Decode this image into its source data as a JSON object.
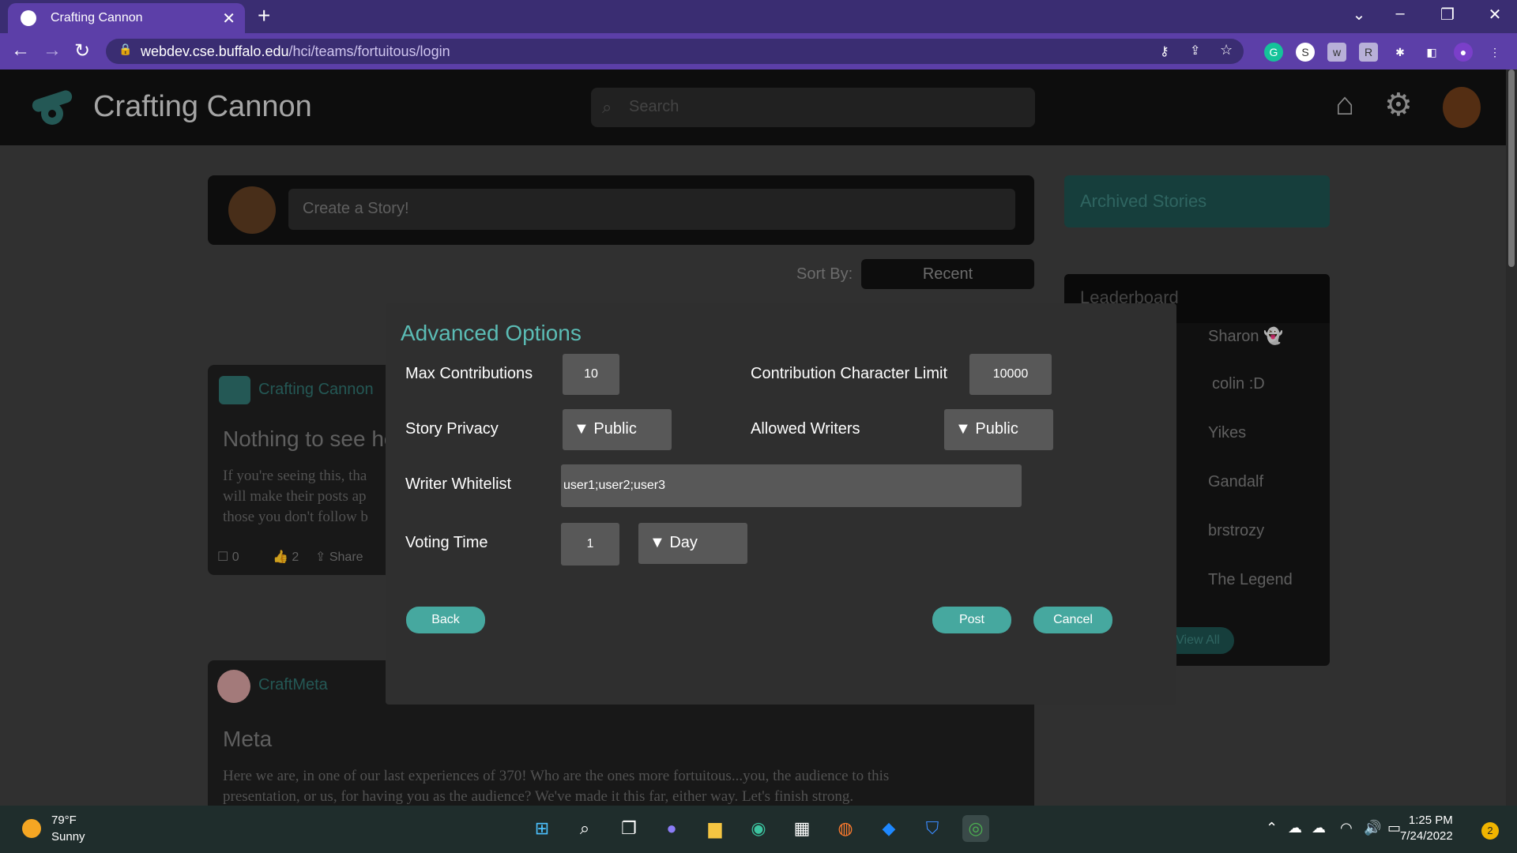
{
  "browser": {
    "tab_title": "Crafting Cannon",
    "url_host": "webdev.cse.buffalo.edu",
    "url_path": "/hci/teams/fortuitous/login"
  },
  "site": {
    "brand": "Crafting Cannon",
    "search_placeholder": "Search",
    "create_story": "Create a Story!",
    "sort_label": "Sort By:",
    "sort_value": "Recent"
  },
  "posts": [
    {
      "author": "Crafting Cannon",
      "title": "Nothing to see he",
      "body_lines": [
        "If you're seeing this, tha",
        "will make their posts ap",
        "those you don't follow b"
      ],
      "comments": "0",
      "likes": "2",
      "share": "Share"
    },
    {
      "author": "CraftMeta",
      "title": "Meta",
      "body_lines": [
        "Here we are, in one of our last experiences of 370! Who are the ones more fortuitous...you, the audience to this",
        "presentation, or us, for having you as the audience? We've made it this far, either way. Let's finish strong."
      ]
    }
  ],
  "sidebar": {
    "archived": "Archived Stories",
    "leaderboard_title": "Leaderboard",
    "leaderboard": [
      "Sharon 👻",
      "colin :D",
      "Yikes",
      "Gandalf",
      "brstrozy",
      "The Legend"
    ],
    "view_all": "View All"
  },
  "modal": {
    "title": "Advanced Options",
    "max_contributions_label": "Max Contributions",
    "max_contributions_value": "10",
    "char_limit_label": "Contribution Character Limit",
    "char_limit_value": "10000",
    "privacy_label": "Story Privacy",
    "privacy_value": "▼ Public",
    "allowed_writers_label": "Allowed Writers",
    "allowed_writers_value": "▼ Public",
    "whitelist_label": "Writer Whitelist",
    "whitelist_value": "user1;user2;user3",
    "voting_label": "Voting Time",
    "voting_value": "1",
    "voting_unit": "▼ Day",
    "back": "Back",
    "post": "Post",
    "cancel": "Cancel"
  },
  "taskbar": {
    "temp": "79°F",
    "condition": "Sunny",
    "time": "1:25 PM",
    "date": "7/24/2022",
    "notifications": "2"
  }
}
